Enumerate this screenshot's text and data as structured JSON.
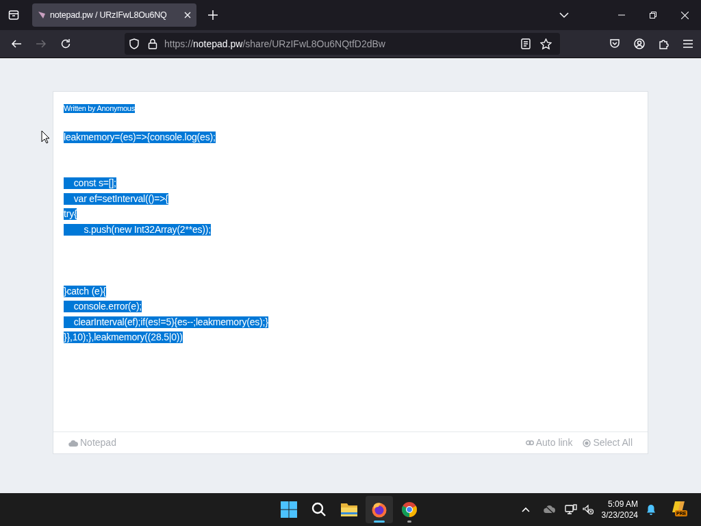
{
  "browser": {
    "tab": {
      "title": "notepad.pw / URzIFwL8Ou6NQ",
      "selected": true
    },
    "url": {
      "origin": "https://",
      "host": "notepad.pw",
      "path": "/share/URzIFwL8Ou6NQtfD2dBw"
    }
  },
  "note": {
    "author": "Written by Anonymous",
    "selected": true,
    "lines": [
      {
        "kind": "text",
        "text": "leakmemory=(es)=>{console.log(es);"
      },
      {
        "kind": "blank"
      },
      {
        "kind": "blank"
      },
      {
        "kind": "text",
        "text": "    const s=[];"
      },
      {
        "kind": "text",
        "text": "    var ef=setInterval(()=>{"
      },
      {
        "kind": "text",
        "text": "try{"
      },
      {
        "kind": "text",
        "text": "        s.push(new Int32Array(2**es));"
      },
      {
        "kind": "blank"
      },
      {
        "kind": "blank"
      },
      {
        "kind": "blank"
      },
      {
        "kind": "text",
        "text": "}catch (e){"
      },
      {
        "kind": "text",
        "text": "    console.error(e);"
      },
      {
        "kind": "text",
        "text": "    clearInterval(ef);if(es!=5){es--;leakmemory(es);}"
      },
      {
        "kind": "text",
        "text": "}},10);},leakmemory((28.5|0))"
      }
    ]
  },
  "footer": {
    "brand": "Notepad",
    "actions": [
      "Auto link",
      "Select All"
    ]
  },
  "taskbar": {
    "time": "5:09 AM",
    "date": "3/23/2024",
    "badge": "PRE"
  }
}
